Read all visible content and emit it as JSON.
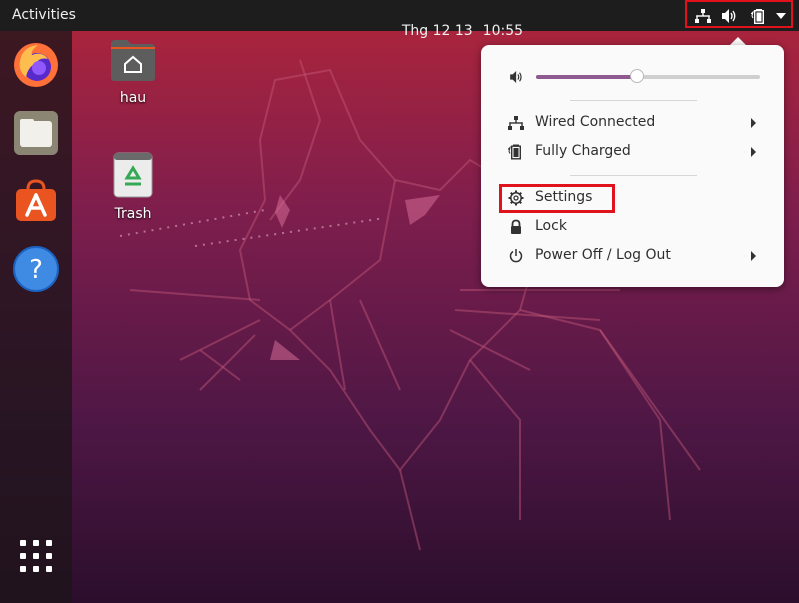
{
  "topbar": {
    "activities_label": "Activities",
    "date": "Thg 12 13",
    "time": "10:55"
  },
  "tray_icons": [
    "network-wired-icon",
    "volume-icon",
    "battery-icon",
    "dropdown-arrow-icon"
  ],
  "dock": {
    "items": [
      "firefox-icon",
      "files-icon",
      "software-store-icon",
      "help-icon"
    ],
    "show_apps": "app-grid-icon"
  },
  "desktop": {
    "icons": [
      {
        "label": "hau",
        "icon": "home-folder-icon"
      },
      {
        "label": "Trash",
        "icon": "trash-icon"
      }
    ]
  },
  "system_menu": {
    "volume_level": 0.45,
    "items": [
      {
        "label": "Wired Connected",
        "icon": "network-wired-icon",
        "submenu": true
      },
      {
        "label": "Fully Charged",
        "icon": "battery-icon",
        "submenu": true
      },
      {
        "label": "Settings",
        "icon": "settings-icon",
        "submenu": false
      },
      {
        "label": "Lock",
        "icon": "lock-icon",
        "submenu": false
      },
      {
        "label": "Power Off / Log Out",
        "icon": "power-icon",
        "submenu": true
      }
    ]
  },
  "colors": {
    "highlight": "#e0121c",
    "topbar": "#1d1d1d",
    "menu_bg": "#fafafa",
    "slider_fill": "#8f5a8f"
  }
}
